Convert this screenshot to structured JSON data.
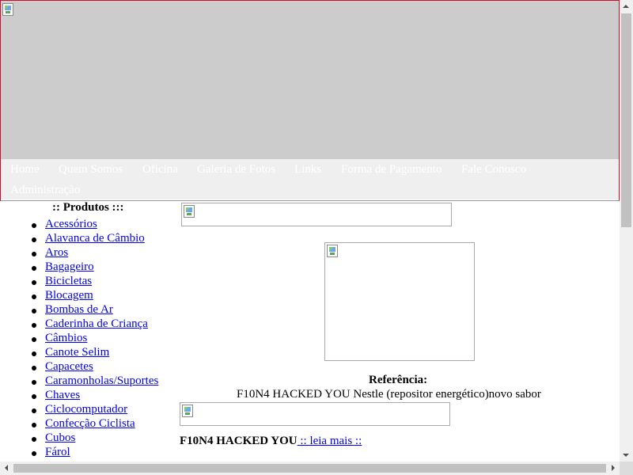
{
  "header": {
    "banner_icon": "broken-image-icon"
  },
  "nav": {
    "items": [
      {
        "label": "Home"
      },
      {
        "label": "Quem Somos"
      },
      {
        "label": "Oficina"
      },
      {
        "label": "Galeria de Fotos"
      },
      {
        "label": "Links"
      },
      {
        "label": "Forma de Pagamento"
      },
      {
        "label": "Fale Conosco"
      },
      {
        "label": "Administração"
      }
    ]
  },
  "sidebar": {
    "title": ":: Produtos :::",
    "items": [
      {
        "label": "Acessórios"
      },
      {
        "label": "Alavanca de Câmbio"
      },
      {
        "label": "Aros"
      },
      {
        "label": "Bagageiro"
      },
      {
        "label": "Bicicletas"
      },
      {
        "label": "Blocagem"
      },
      {
        "label": "Bombas de Ar"
      },
      {
        "label": "Caderinha de Criança"
      },
      {
        "label": "Câmbios"
      },
      {
        "label": "Canote Selim"
      },
      {
        "label": "Capacetes"
      },
      {
        "label": "Caramonholas/Suportes"
      },
      {
        "label": "Chaves"
      },
      {
        "label": "Ciclocomputador"
      },
      {
        "label": "Confecção Ciclista"
      },
      {
        "label": "Cubos"
      },
      {
        "label": "Fárol"
      }
    ]
  },
  "main": {
    "reference_label": "Referência:",
    "reference_text": "F10N4 HACKED YOU Nestle (repositor energético)novo sabor",
    "news_title": "F10N4 HACKED YOU",
    "read_more": " :: leia mais ::"
  },
  "colors": {
    "banner": "#cccccc",
    "navbar": "#efefef",
    "nav_text": "#ffffff",
    "link": "#0000ee",
    "border": "#c8102e"
  }
}
